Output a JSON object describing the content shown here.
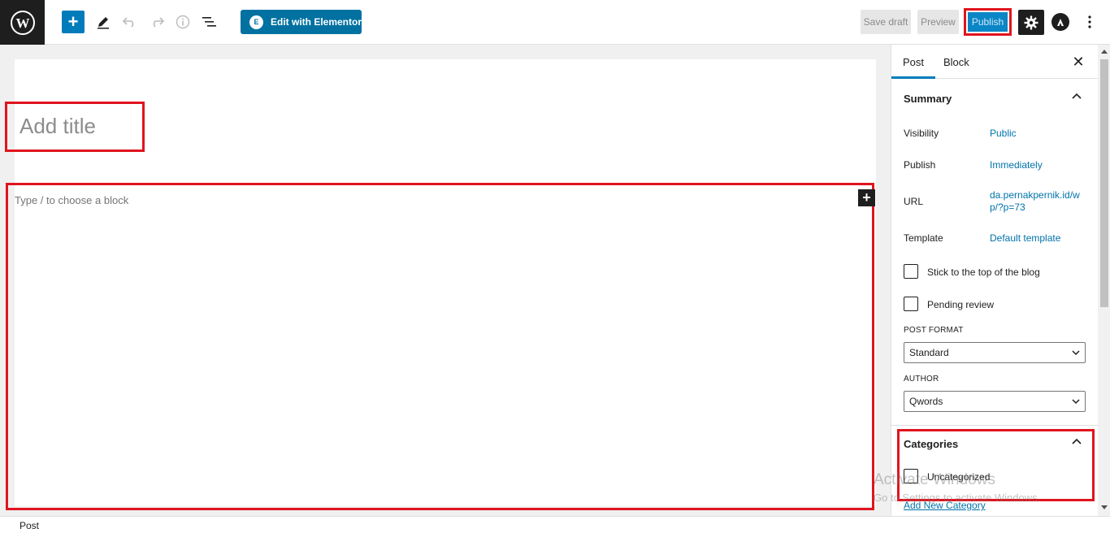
{
  "toolbar": {
    "elementor_label": "Edit with Elementor",
    "save_draft_label": "Save draft",
    "preview_label": "Preview",
    "publish_label": "Publish"
  },
  "editor": {
    "title_placeholder": "Add title",
    "block_placeholder": "Type / to choose a block"
  },
  "sidebar": {
    "tabs": [
      "Post",
      "Block"
    ],
    "summary": {
      "heading": "Summary",
      "rows": [
        {
          "label": "Visibility",
          "value": "Public"
        },
        {
          "label": "Publish",
          "value": "Immediately"
        },
        {
          "label": "URL",
          "value_line1": "da.pernakpernik.id/w",
          "value_line2": "p/?p=73"
        },
        {
          "label": "Template",
          "value": "Default template"
        }
      ],
      "stick_label": "Stick to the top of the blog",
      "pending_label": "Pending review",
      "post_format_label": "POST FORMAT",
      "post_format_value": "Standard",
      "author_label": "AUTHOR",
      "author_value": "Qwords"
    },
    "categories": {
      "heading": "Categories",
      "items": [
        "Uncategorized"
      ],
      "add_new": "Add New Category"
    }
  },
  "watermark": {
    "line1": "Activate Windows",
    "line2": "Go to Settings to activate Windows."
  },
  "footer": {
    "breadcrumb": "Post"
  },
  "icons": [
    "wordpress-logo-icon",
    "plus-icon",
    "pencil-icon",
    "undo-icon",
    "redo-icon",
    "info-icon",
    "list-view-icon",
    "gear-icon",
    "astra-icon",
    "more-vertical-icon",
    "close-icon",
    "chevron-up-icon",
    "chevron-down-icon"
  ]
}
